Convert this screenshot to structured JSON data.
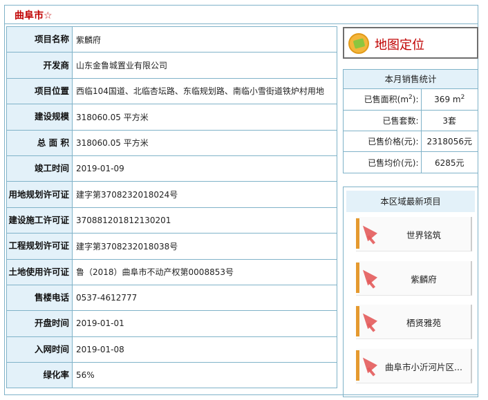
{
  "header": {
    "title": "曲阜市☆"
  },
  "info_rows": [
    {
      "label": "项目名称",
      "value": "紫麟府"
    },
    {
      "label": "开发商",
      "value": "山东金鲁城置业有限公司"
    },
    {
      "label": "项目位置",
      "value": "西临104国道、北临杏坛路、东临规划路、南临小雪街道铁炉村用地"
    },
    {
      "label": "建设规模",
      "value": "318060.05 平方米"
    },
    {
      "label": "总 面 积",
      "value": "318060.05 平方米"
    },
    {
      "label": "竣工时间",
      "value": "2019-01-09"
    },
    {
      "label": "用地规划许可证",
      "value": "建字第3708232018024号"
    },
    {
      "label": "建设施工许可证",
      "value": "370881201812130201"
    },
    {
      "label": "工程规划许可证",
      "value": "建字第3708232018038号"
    },
    {
      "label": "土地使用许可证",
      "value": "鲁（2018）曲阜市不动产权第0008853号"
    },
    {
      "label": "售楼电话",
      "value": "0537-4612777"
    },
    {
      "label": "开盘时间",
      "value": "2019-01-01"
    },
    {
      "label": "入网时间",
      "value": "2019-01-08"
    },
    {
      "label": "绿化率",
      "value": "56%"
    }
  ],
  "map_button": {
    "label": "地图定位",
    "icon": "map-location-icon"
  },
  "monthly_stats": {
    "title": "本月销售统计",
    "rows": [
      {
        "key": "已售面积(m",
        "key_sup": "2",
        "key_end": "):",
        "value": "369 m",
        "value_sup": "2"
      },
      {
        "key": "已售套数:",
        "key_sup": "",
        "key_end": "",
        "value": "3套",
        "value_sup": ""
      },
      {
        "key": "已售价格(元):",
        "key_sup": "",
        "key_end": "",
        "value": "2318056元",
        "value_sup": ""
      },
      {
        "key": "已售均价(元):",
        "key_sup": "",
        "key_end": "",
        "value": "6285元",
        "value_sup": ""
      }
    ]
  },
  "latest_projects": {
    "title": "本区域最新项目",
    "items": [
      {
        "name": "世界铭筑"
      },
      {
        "name": "紫麟府"
      },
      {
        "name": "栖贤雅苑"
      },
      {
        "name": "曲阜市小沂河片区..."
      }
    ]
  },
  "colors": {
    "accent_red": "#c00000",
    "label_bg": "#e3f1f9",
    "border": "#7fb2c8"
  }
}
